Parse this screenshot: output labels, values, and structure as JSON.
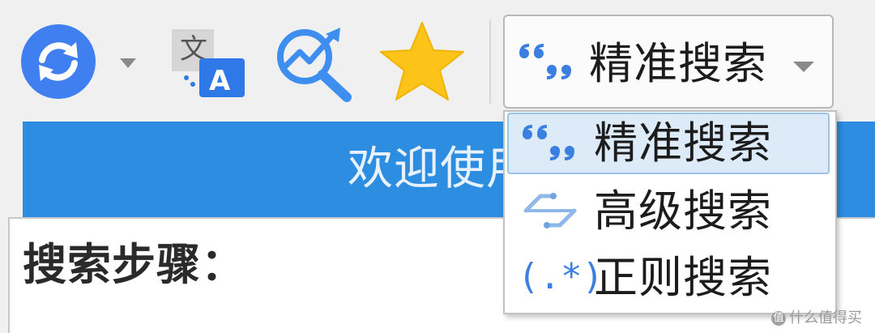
{
  "toolbar": {
    "buttons": [
      {
        "name": "sync",
        "icon": "sync-icon"
      },
      {
        "name": "translate",
        "icon": "translate-icon"
      },
      {
        "name": "analytics-search",
        "icon": "analytics-search-icon"
      },
      {
        "name": "favorite",
        "icon": "star-icon"
      }
    ],
    "search_mode": {
      "selected_label": "精准搜索",
      "icon": "quote-icon"
    }
  },
  "dropdown": {
    "items": [
      {
        "label": "精准搜索",
        "icon": "quote-icon",
        "selected": true
      },
      {
        "label": "高级搜索",
        "icon": "advanced-search-icon",
        "selected": false
      },
      {
        "label": "正则搜索",
        "icon": "regex-icon",
        "selected": false
      }
    ],
    "regex_glyph": "(.*)"
  },
  "welcome": {
    "title": "欢迎使用"
  },
  "content": {
    "steps_heading": "搜索步骤："
  },
  "watermark": {
    "badge": "值",
    "text": "什么值得买"
  },
  "colors": {
    "accent_blue": "#2d8de0",
    "sync_blue": "#3f7ff0",
    "star_yellow": "#fcc419",
    "selected_bg": "#dcebf7"
  }
}
